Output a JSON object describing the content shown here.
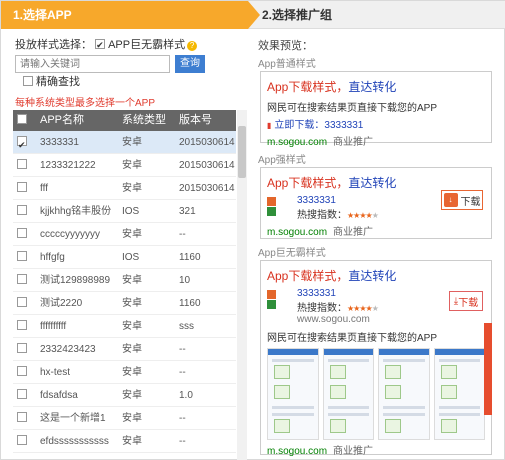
{
  "steps": {
    "step1": "1.选择APP",
    "step2": "2.选择推广组"
  },
  "left": {
    "label": "投放样式选择：",
    "option": "APP巨无霸样式",
    "help_icon": "help-icon",
    "search_placeholder": "请输入关键词",
    "search_button": "查询",
    "exact_label": "精确查找",
    "warning": "每种系统类型最多选择一个APP",
    "columns": [
      "APP名称",
      "系统类型",
      "版本号"
    ],
    "rows": [
      {
        "name": "3333331",
        "system": "安卓",
        "version": "2015030614",
        "selected": true
      },
      {
        "name": "1233321222",
        "system": "安卓",
        "version": "2015030614",
        "selected": false
      },
      {
        "name": "fff",
        "system": "安卓",
        "version": "2015030614",
        "selected": false
      },
      {
        "name": "kjjkhhg铭丰股份",
        "system": "IOS",
        "version": "321",
        "selected": false
      },
      {
        "name": "cccccyyyyyyy",
        "system": "安卓",
        "version": "--",
        "selected": false
      },
      {
        "name": "hffgfg",
        "system": "IOS",
        "version": "1160",
        "selected": false
      },
      {
        "name": "测试129898989",
        "system": "安卓",
        "version": "10",
        "selected": false
      },
      {
        "name": "测试2220",
        "system": "安卓",
        "version": "1160",
        "selected": false
      },
      {
        "name": "ffffffffff",
        "system": "安卓",
        "version": "sss",
        "selected": false
      },
      {
        "name": "2332423423",
        "system": "安卓",
        "version": "--",
        "selected": false
      },
      {
        "name": "hx-test",
        "system": "安卓",
        "version": "--",
        "selected": false
      },
      {
        "name": "fdsafdsa",
        "system": "安卓",
        "version": "1.0",
        "selected": false
      },
      {
        "name": "这是一个新增1",
        "system": "安卓",
        "version": "--",
        "selected": false
      },
      {
        "name": "efdsssssssssss",
        "system": "安卓",
        "version": "--",
        "selected": false
      }
    ]
  },
  "right": {
    "title": "效果预览：",
    "sections": {
      "normal": "App普通样式",
      "strong": "App强样式",
      "giant": "App巨无霸样式"
    },
    "ad_title_red": "App下载样式，",
    "ad_title_blue": "直达转化",
    "ad_desc": "网民可在搜索结果页直接下载您的APP",
    "download_prefix": "立即下载：",
    "app_name": "3333331",
    "hot_index_label": "热搜指数：",
    "url": "m.sogou.com",
    "promo": "商业推广",
    "url_www": "www.sogou.com",
    "download_btn": "下载",
    "rating": 4,
    "rating_max": 5,
    "colors": {
      "accent": "#f7a82b",
      "title_red": "#d8321f",
      "link_blue": "#2144b8",
      "url_green": "#008000",
      "warning": "#e03b2e",
      "button_blue": "#3d7ed1"
    }
  }
}
